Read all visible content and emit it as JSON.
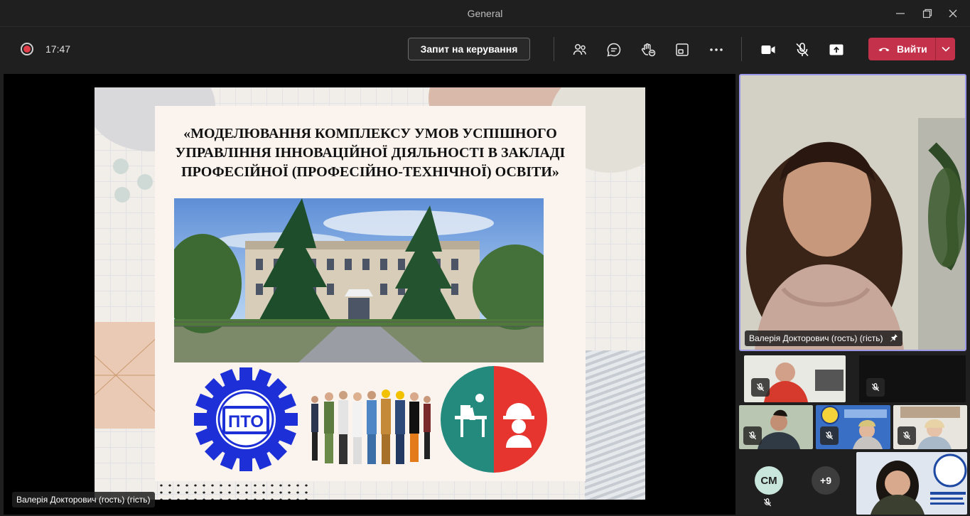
{
  "window": {
    "title": "General"
  },
  "toolbar": {
    "time": "17:47",
    "request_control_label": "Запит на керування",
    "leave_label": "Вийти"
  },
  "slide": {
    "title_line1": "«МОДЕЛЮВАННЯ КОМПЛЕКСУ УМОВ УСПІШНОГО",
    "title_line2": "УПРАВЛІННЯ ІННОВАЦІЙНОЇ ДІЯЛЬНОСТІ  В ЗАКЛАДІ",
    "title_line3": "ПРОФЕСІЙНОЇ (ПРОФЕСІЙНО-ТЕХНІЧНОЇ)  ОСВІТИ»",
    "logo_text": "ПТО"
  },
  "presenter_name": "Валерія Докторович (гость) (гість)",
  "speaker_name": "Валерія Докторович (гость) (гість)",
  "participants": {
    "avatar_initials": "CM",
    "overflow_count": "+9"
  },
  "colors": {
    "accent": "#9b97e8",
    "leave": "#c4314b",
    "record": "#e03e4a"
  }
}
